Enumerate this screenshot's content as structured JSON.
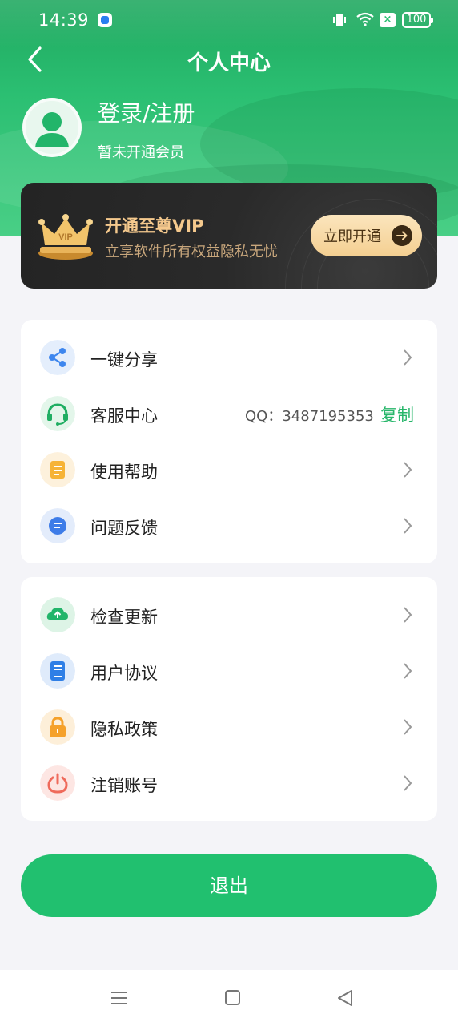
{
  "status_bar": {
    "time": "14:39",
    "battery": "100",
    "icons": [
      "app-icon",
      "vibrate-icon",
      "wifi-icon",
      "x-icon",
      "battery-icon"
    ]
  },
  "header": {
    "title": "个人中心",
    "back_icon": "chevron-left-icon"
  },
  "profile": {
    "login_text": "登录/注册",
    "member_status": "暂未开通会员",
    "avatar_icon": "user-avatar-icon"
  },
  "vip": {
    "title": "开通至尊VIP",
    "subtitle": "立享软件所有权益隐私无忧",
    "button_label": "立即开通",
    "crown_label": "VIP",
    "colors": {
      "card": "#2a2a2a",
      "gold": "#f5c98d",
      "button": "#f4cf91"
    }
  },
  "menu_group_1": [
    {
      "label": "一键分享",
      "icon": "share-icon"
    },
    {
      "label": "客服中心",
      "icon": "headset-icon",
      "extra": "QQ：3487195353",
      "action": "复制"
    },
    {
      "label": "使用帮助",
      "icon": "help-doc-icon"
    },
    {
      "label": "问题反馈",
      "icon": "feedback-icon"
    }
  ],
  "menu_group_2": [
    {
      "label": "检查更新",
      "icon": "cloud-upload-icon"
    },
    {
      "label": "用户协议",
      "icon": "agreement-icon"
    },
    {
      "label": "隐私政策",
      "icon": "lock-icon"
    },
    {
      "label": "注销账号",
      "icon": "power-icon"
    }
  ],
  "logout": {
    "label": "退出"
  },
  "colors": {
    "accent": "#21c06f",
    "background": "#f4f4f8"
  },
  "nav": {
    "icons": [
      "menu-icon",
      "home-icon",
      "back-icon"
    ]
  }
}
